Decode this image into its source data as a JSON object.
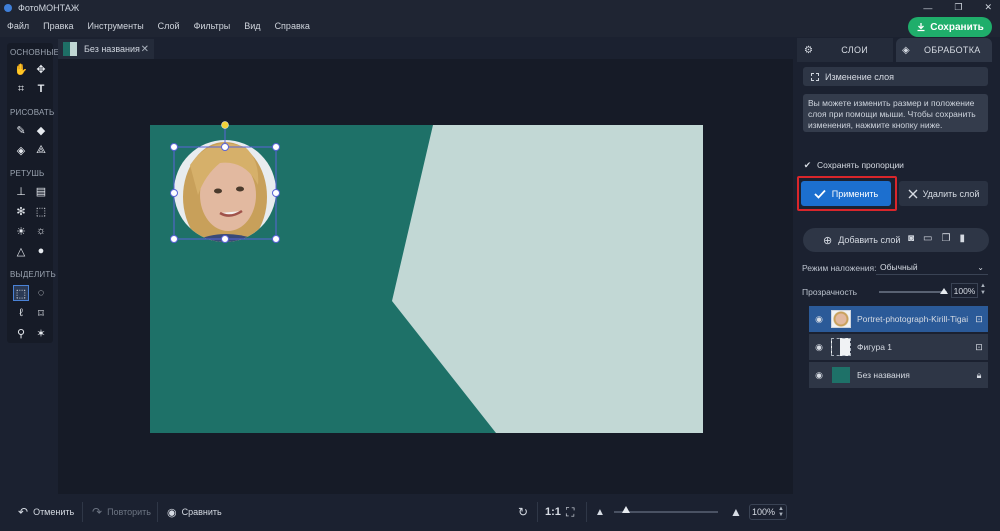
{
  "window": {
    "title": "ФотоМОНТАЖ",
    "controls": [
      "—",
      "❐",
      "✕"
    ]
  },
  "menu": [
    "Файл",
    "Правка",
    "Инструменты",
    "Слой",
    "Фильтры",
    "Вид",
    "Справка"
  ],
  "save_button": "Сохранить",
  "toolbar": {
    "sections": [
      "ОСНОВНЫЕ",
      "РИСОВАТЬ",
      "РЕТУШЬ",
      "ВЫДЕЛИТЬ"
    ]
  },
  "document_tab": {
    "name": "Без названия",
    "close": "✕"
  },
  "canvas": {
    "colors": {
      "dark": "#1e7168",
      "light": "#c2d8d5"
    }
  },
  "bottom": {
    "undo": "Отменить",
    "redo": "Повторить",
    "compare": "Сравнить",
    "ratio": "1:1",
    "zoom": "100%"
  },
  "right_panel": {
    "tabs": [
      "СЛОИ",
      "ОБРАБОТКА"
    ],
    "header": "Изменение слоя",
    "info": "Вы можете изменить размер и положение слоя при помощи мыши. Чтобы сохранить изменения, нажмите кнопку ниже.",
    "keep_proportions": "Сохранять пропорции",
    "apply": "Применить",
    "delete": "Удалить слой",
    "add_layer": "Добавить слой",
    "blend_label": "Режим наложения:",
    "blend_value": "Обычный",
    "opacity_label": "Прозрачность",
    "opacity_value": "100%",
    "layers": [
      {
        "name": "Portret-photograph-Kirill-Tigai",
        "selected": true,
        "locked": false
      },
      {
        "name": "Фигура 1",
        "selected": false,
        "locked": false
      },
      {
        "name": "Без названия",
        "selected": false,
        "locked": true
      }
    ]
  }
}
